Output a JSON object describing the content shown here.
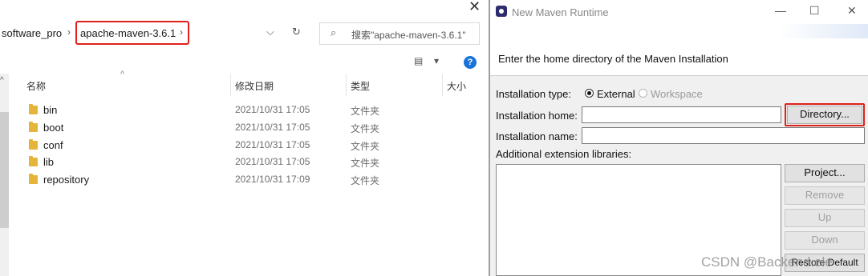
{
  "explorer": {
    "breadcrumb": {
      "previous": "software_pro",
      "current": "apache-maven-3.6.1",
      "separator": "›"
    },
    "address_controls": {
      "dropdown": "⌵",
      "refresh": "↻"
    },
    "search": {
      "placeholder": "搜索\"apache-maven-3.6.1\""
    },
    "close": "✕",
    "view": {
      "layout_icon": "▤",
      "dropdown": "▾"
    },
    "help": "?",
    "columns": {
      "name": "名称",
      "date": "修改日期",
      "type": "类型",
      "size": "大小"
    },
    "rows": [
      {
        "name": "bin",
        "date": "2021/10/31 17:05",
        "type": "文件夹"
      },
      {
        "name": "boot",
        "date": "2021/10/31 17:05",
        "type": "文件夹"
      },
      {
        "name": "conf",
        "date": "2021/10/31 17:05",
        "type": "文件夹"
      },
      {
        "name": "lib",
        "date": "2021/10/31 17:05",
        "type": "文件夹"
      },
      {
        "name": "repository",
        "date": "2021/10/31 17:09",
        "type": "文件夹"
      }
    ]
  },
  "dialog": {
    "title": "New Maven Runtime",
    "window_controls": {
      "minimize": "—",
      "maximize": "☐",
      "close": "✕"
    },
    "header_text": "Enter the home directory of the Maven Installation",
    "installation_type": {
      "label": "Installation type:",
      "external": "External",
      "workspace": "Workspace",
      "selected": "External"
    },
    "installation_home": {
      "label": "Installation home:",
      "value": ""
    },
    "directory_button": "Directory...",
    "installation_name": {
      "label": "Installation name:",
      "value": ""
    },
    "extensions_label": "Additional extension libraries:",
    "buttons": {
      "project": "Project...",
      "remove": "Remove",
      "up": "Up",
      "down": "Down",
      "restore": "Restore Default"
    },
    "watermark": "CSDN @Backend.ele"
  },
  "colors": {
    "highlight": "#e0201a",
    "folder": "#e5b43a",
    "help": "#1a73d9",
    "dialog_bg": "#f0f0f0"
  }
}
